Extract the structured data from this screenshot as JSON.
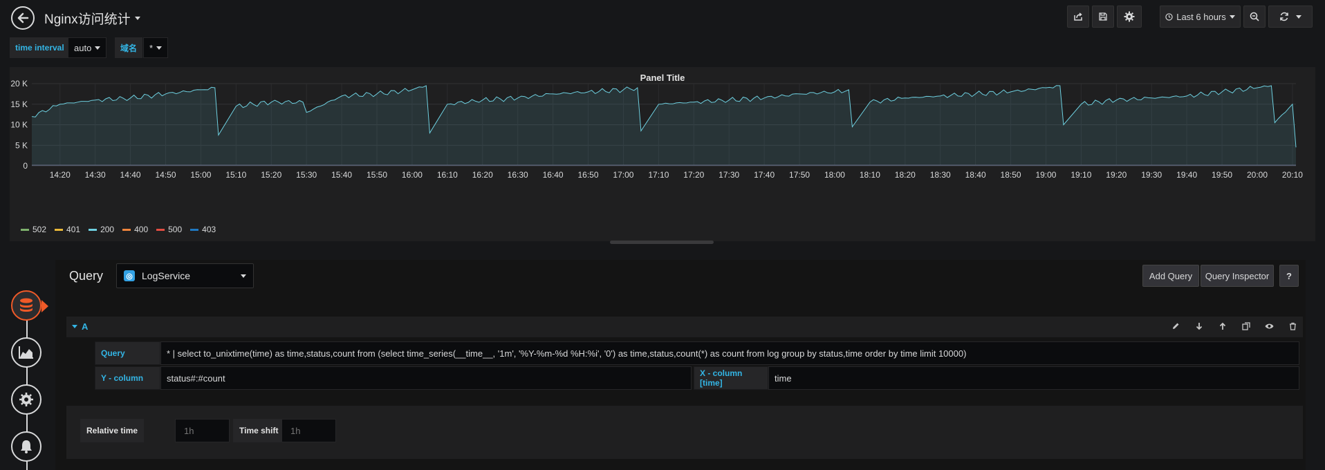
{
  "header": {
    "title": "Nginx访问统计",
    "time_range": "Last 6 hours"
  },
  "variables": [
    {
      "label": "time interval",
      "value": "auto"
    },
    {
      "label": "域名",
      "value": "*"
    }
  ],
  "panel": {
    "title": "Panel Title",
    "legend": [
      {
        "name": "502",
        "color": "#7eb26d"
      },
      {
        "name": "401",
        "color": "#eab839"
      },
      {
        "name": "200",
        "color": "#6ed0e0"
      },
      {
        "name": "400",
        "color": "#ef843c"
      },
      {
        "name": "500",
        "color": "#e24d42"
      },
      {
        "name": "403",
        "color": "#1f78c1"
      }
    ]
  },
  "chart_data": {
    "type": "area",
    "title": "Panel Title",
    "x_ticks": [
      "14:20",
      "14:30",
      "14:40",
      "14:50",
      "15:00",
      "15:10",
      "15:20",
      "15:30",
      "15:40",
      "15:50",
      "16:00",
      "16:10",
      "16:20",
      "16:30",
      "16:40",
      "16:50",
      "17:00",
      "17:10",
      "17:20",
      "17:30",
      "17:40",
      "17:50",
      "18:00",
      "18:10",
      "18:20",
      "18:30",
      "18:40",
      "18:50",
      "19:00",
      "19:10",
      "19:20",
      "19:30",
      "19:40",
      "19:50",
      "20:00",
      "20:10"
    ],
    "y_ticks": [
      "0",
      "5 K",
      "10 K",
      "15 K",
      "20 K"
    ],
    "ylim": [
      0,
      20000
    ],
    "grid": true,
    "legend_position": "bottom-left",
    "series": [
      {
        "name": "200",
        "x": [
          "14:12",
          "14:20",
          "14:30",
          "14:40",
          "14:50",
          "15:00",
          "15:04",
          "15:05",
          "15:10",
          "15:20",
          "15:29",
          "15:30",
          "15:40",
          "15:50",
          "16:00",
          "16:04",
          "16:05",
          "16:10",
          "16:20",
          "16:30",
          "16:40",
          "16:50",
          "17:00",
          "17:04",
          "17:05",
          "17:10",
          "17:20",
          "17:30",
          "17:40",
          "17:50",
          "18:00",
          "18:04",
          "18:05",
          "18:10",
          "18:20",
          "18:30",
          "18:40",
          "18:50",
          "19:00",
          "19:04",
          "19:05",
          "19:10",
          "19:20",
          "19:30",
          "19:40",
          "19:50",
          "20:00",
          "20:04",
          "20:05",
          "20:10",
          "20:11"
        ],
        "values": [
          12000,
          15000,
          16000,
          16500,
          17500,
          18500,
          19000,
          7500,
          14500,
          15500,
          15500,
          13000,
          17000,
          17500,
          18500,
          19500,
          8000,
          15000,
          16000,
          16500,
          17500,
          18000,
          18500,
          19000,
          8500,
          15000,
          15500,
          16000,
          16500,
          17500,
          18000,
          18500,
          9500,
          15500,
          16500,
          17000,
          17500,
          18000,
          19000,
          19500,
          10000,
          15000,
          16000,
          16500,
          17000,
          18000,
          19000,
          19500,
          10500,
          15000,
          4500
        ]
      },
      {
        "name": "502",
        "values": [
          0
        ]
      },
      {
        "name": "401",
        "values": [
          0
        ]
      },
      {
        "name": "400",
        "values": [
          0
        ]
      },
      {
        "name": "500",
        "values": [
          0
        ]
      },
      {
        "name": "403",
        "values": [
          0
        ]
      }
    ]
  },
  "editor": {
    "label": "Query",
    "datasource": "LogService",
    "add_query": "Add Query",
    "query_inspector": "Query Inspector",
    "help": "?",
    "row_name": "A",
    "query_label": "Query",
    "query_value": "* | select to_unixtime(time) as time,status,count from (select time_series(__time__, '1m', '%Y-%m-%d %H:%i', '0')  as time,status,count(*) as count from log group by status,time order by time limit 10000)",
    "ycol_label": "Y - column",
    "ycol_value": "status#:#count",
    "xcol_label": "X - column [time]",
    "xcol_value": "time",
    "relative_time_label": "Relative time",
    "relative_time_placeholder": "1h",
    "time_shift_label": "Time shift",
    "time_shift_placeholder": "1h"
  }
}
